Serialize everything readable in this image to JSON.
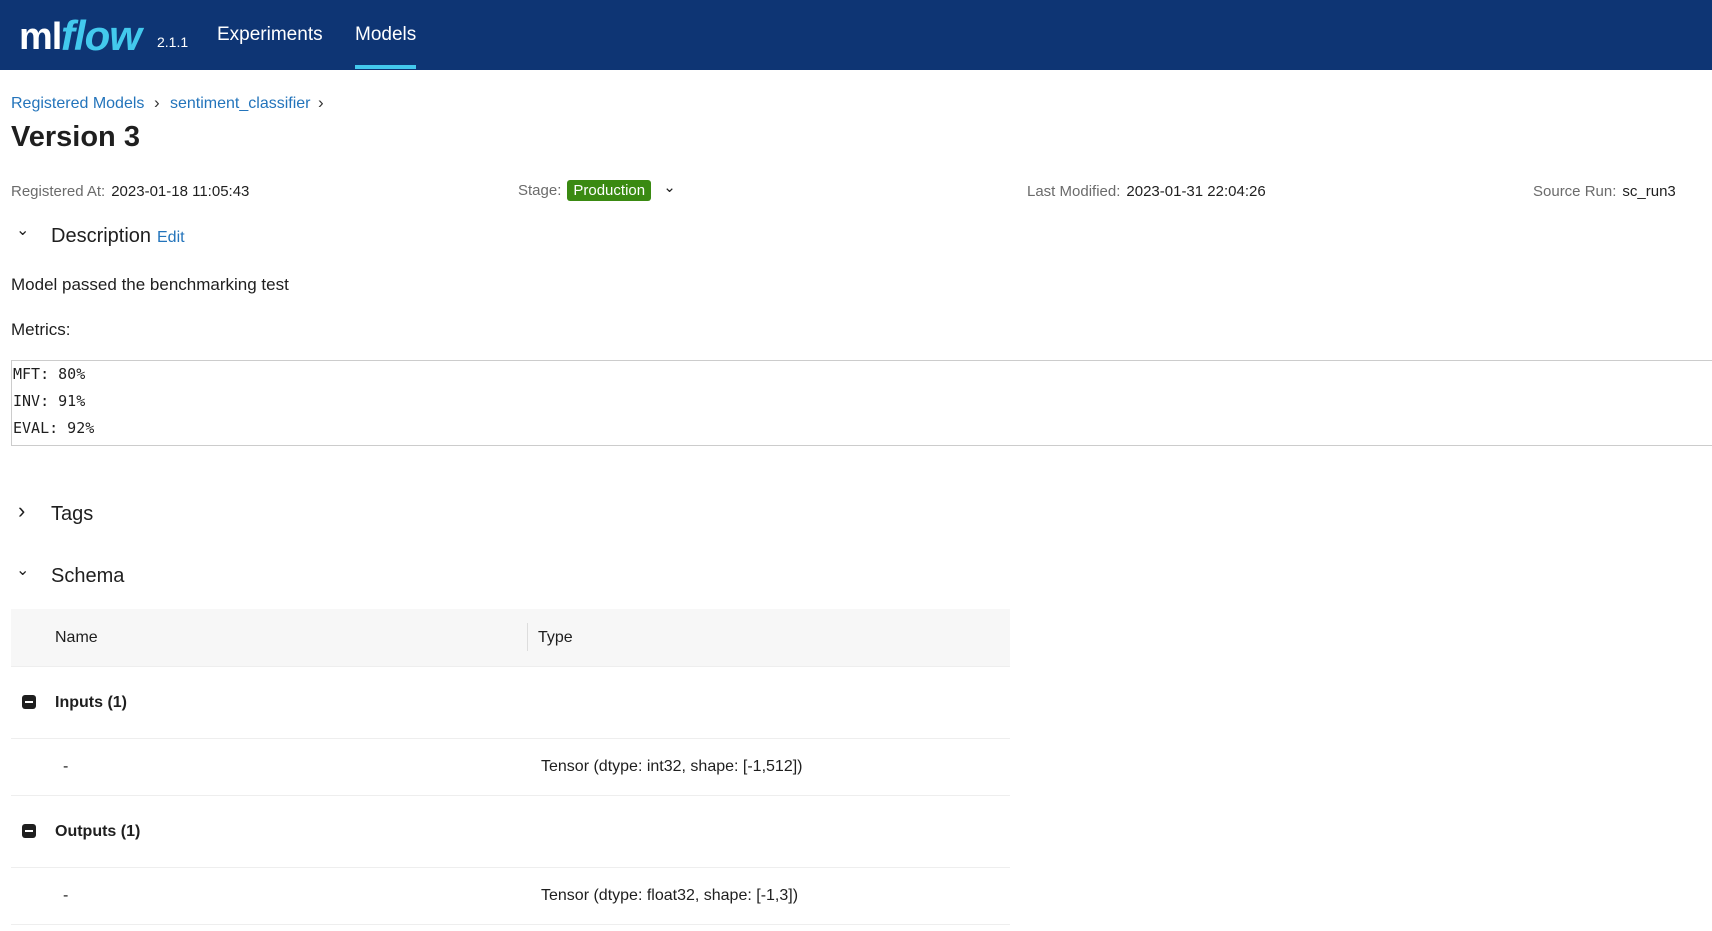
{
  "app": {
    "logo_ml": "ml",
    "logo_flow": "flow",
    "version": "2.1.1",
    "brand_color": "#0e3574",
    "accent_color": "#43c9ed"
  },
  "nav": {
    "experiments": "Experiments",
    "models": "Models",
    "active": "Models"
  },
  "breadcrumb": {
    "registered_models": "Registered Models",
    "model_name": "sentiment_classifier",
    "separator": "›"
  },
  "page_title": "Version 3",
  "meta": {
    "registered_at_label": "Registered At:",
    "registered_at_value": "2023-01-18 11:05:43",
    "stage_label": "Stage:",
    "stage_value": "Production",
    "stage_color": "#3a8a12",
    "last_modified_label": "Last Modified:",
    "last_modified_value": "2023-01-31 22:04:26",
    "source_run_label": "Source Run:",
    "source_run_value": "sc_run3"
  },
  "description": {
    "title": "Description",
    "edit_label": "Edit",
    "text": "Model passed the benchmarking test",
    "metrics_label": "Metrics:",
    "code_lines": [
      "MFT: 80%",
      "INV: 91%",
      "EVAL: 92%"
    ]
  },
  "tags": {
    "title": "Tags"
  },
  "schema": {
    "title": "Schema",
    "columns": {
      "name": "Name",
      "type": "Type"
    },
    "inputs": {
      "label": "Inputs (1)",
      "rows": [
        {
          "name": "-",
          "type": "Tensor (dtype: int32, shape: [-1,512])"
        }
      ]
    },
    "outputs": {
      "label": "Outputs (1)",
      "rows": [
        {
          "name": "-",
          "type": "Tensor (dtype: float32, shape: [-1,3])"
        }
      ]
    }
  },
  "icons": {
    "chevron_down": "⌄",
    "chevron_right": "›",
    "collapse": "minus-square-icon"
  }
}
